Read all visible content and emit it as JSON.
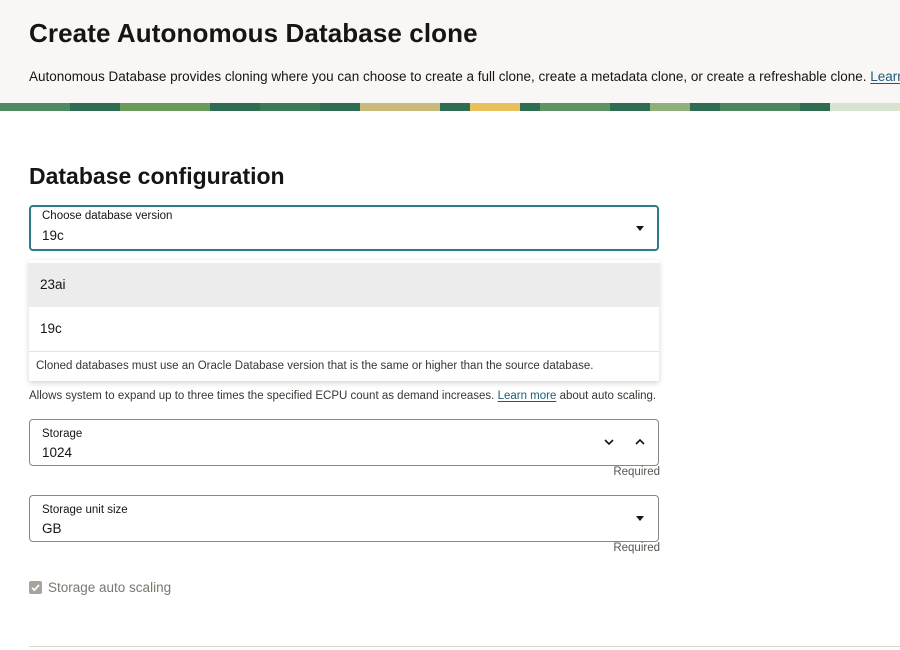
{
  "header": {
    "title": "Create Autonomous Database clone",
    "description": "Autonomous Database provides cloning where you can choose to create a full clone, create a metadata clone, or create a refreshable clone.",
    "learn_more": "Learn more",
    "period": "."
  },
  "section": {
    "title": "Database configuration"
  },
  "db_version": {
    "label": "Choose database version",
    "value": "19c",
    "options": [
      {
        "label": "23ai"
      },
      {
        "label": "19c"
      }
    ],
    "help": "Cloned databases must use an Oracle Database version that is the same or higher than the source database."
  },
  "auto_scaling_help": {
    "prefix": "Allows system to expand up to three times the specified ECPU count as demand increases.",
    "link": "Learn more",
    "suffix": "about auto scaling."
  },
  "storage": {
    "label": "Storage",
    "value": "1024",
    "required": "Required"
  },
  "storage_unit": {
    "label": "Storage unit size",
    "value": "GB",
    "required": "Required"
  },
  "storage_auto_scaling": {
    "label": "Storage auto scaling",
    "checked": true,
    "disabled": true
  },
  "colors": {
    "accent": "#2c7a8a",
    "link": "#1e5a78",
    "banner": "#2f6d52"
  }
}
